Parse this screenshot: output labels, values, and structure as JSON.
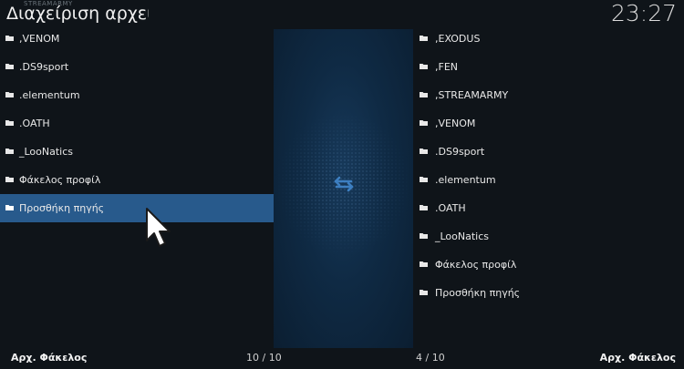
{
  "header": {
    "title": "Διαχείριση αρχείων",
    "subtitle": "STREAMARMY",
    "clock": "23:27"
  },
  "left_panel": {
    "items": [
      {
        "label": ",VENOM",
        "icon": "folder-icon"
      },
      {
        "label": ".DS9sport",
        "icon": "folder-icon"
      },
      {
        "label": ".elementum",
        "icon": "folder-icon"
      },
      {
        "label": ".OATH",
        "icon": "folder-icon"
      },
      {
        "label": "_LooNatics",
        "icon": "folder-icon"
      },
      {
        "label": "Φάκελος προφίλ",
        "icon": "folder-icon"
      },
      {
        "label": "Προσθήκη πηγής",
        "icon": "folder-icon",
        "selected": true
      }
    ],
    "footer_button": "Αρχ. Φάκελος",
    "count": "10 / 10"
  },
  "right_panel": {
    "items": [
      {
        "label": ",EXODUS",
        "icon": "folder-icon"
      },
      {
        "label": ",FEN",
        "icon": "folder-icon"
      },
      {
        "label": ",STREAMARMY",
        "icon": "folder-icon"
      },
      {
        "label": ",VENOM",
        "icon": "folder-icon"
      },
      {
        "label": ".DS9sport",
        "icon": "folder-icon"
      },
      {
        "label": ".elementum",
        "icon": "folder-icon"
      },
      {
        "label": ".OATH",
        "icon": "folder-icon"
      },
      {
        "label": "_LooNatics",
        "icon": "folder-icon"
      },
      {
        "label": "Φάκελος προφίλ",
        "icon": "folder-icon"
      },
      {
        "label": "Προσθήκη πηγής",
        "icon": "folder-icon"
      }
    ],
    "footer_button": "Αρχ. Φάκελος",
    "count": "4 / 10"
  },
  "center": {
    "icon": "swap-arrows-icon"
  },
  "colors": {
    "background": "#0f1419",
    "selected": "#285a8c",
    "accent": "#3d7fc1"
  }
}
